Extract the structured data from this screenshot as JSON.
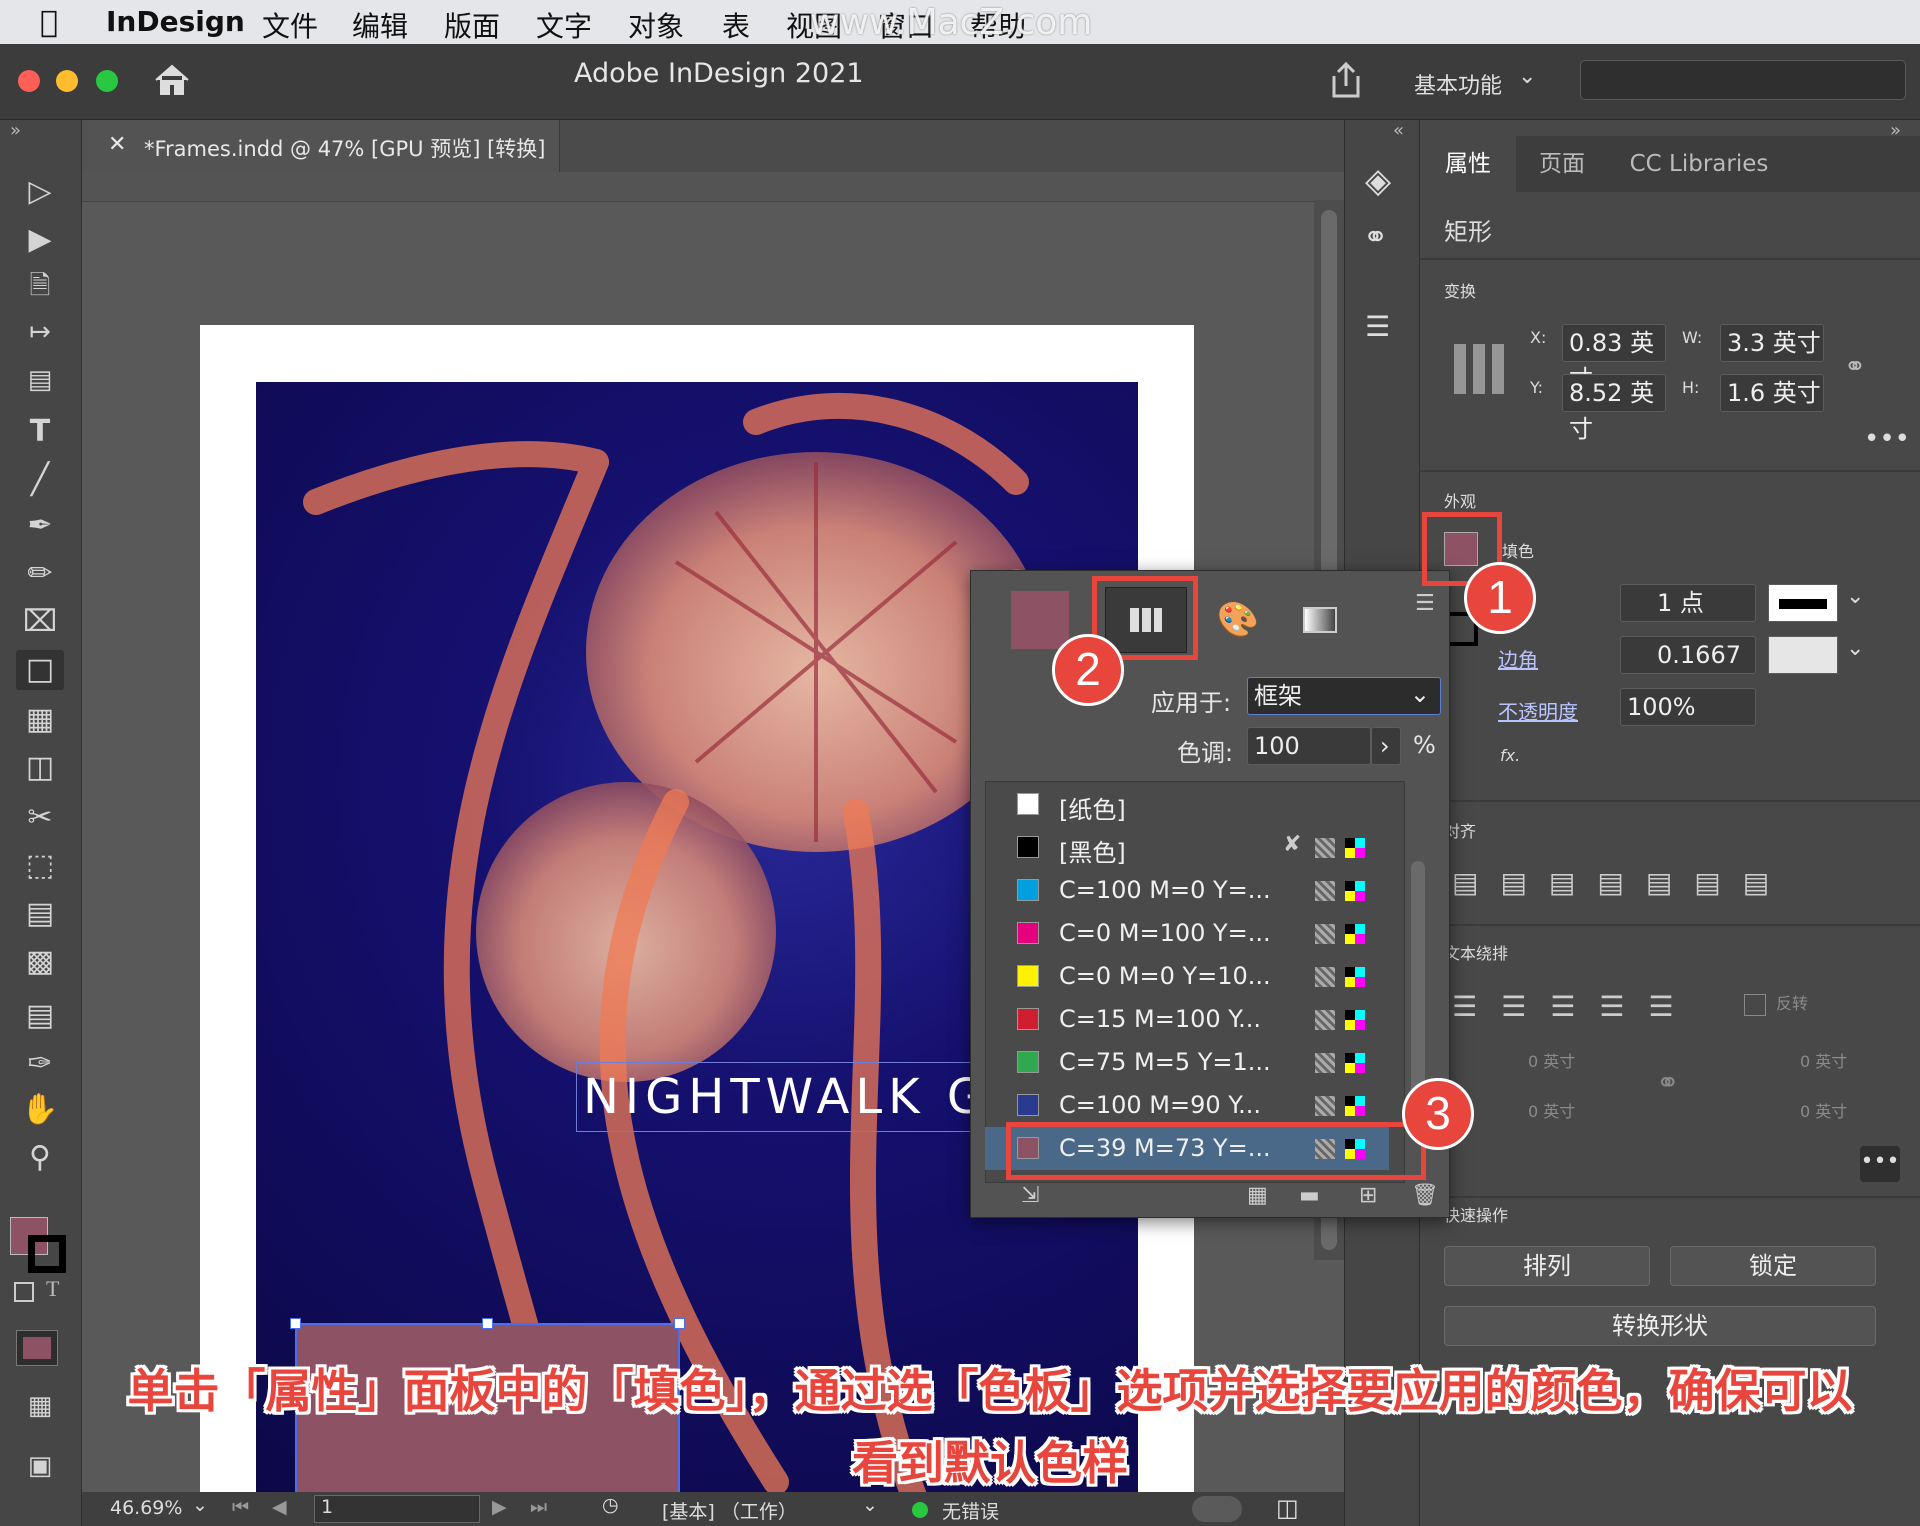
{
  "menubar": {
    "app": "InDesign",
    "items": [
      "文件",
      "编辑",
      "版面",
      "文字",
      "对象",
      "表",
      "视图",
      "窗口",
      "帮助"
    ],
    "watermark": "www.MacZ.com"
  },
  "titlebar": {
    "title": "Adobe InDesign 2021",
    "workspace": "基本功能"
  },
  "document": {
    "tab_label": "*Frames.indd @ 47% [GPU 预览] [转换]",
    "headline_text": "NIGHTWALK GU"
  },
  "statusbar": {
    "zoom": "46.69%",
    "page": "1",
    "profile": "[基本] （工作）",
    "errors": "无错误"
  },
  "properties": {
    "tabs": [
      "属性",
      "页面",
      "CC Libraries"
    ],
    "object_type": "矩形",
    "transform_title": "变换",
    "x_label": "X:",
    "x_value": "0.83 英寸",
    "y_label": "Y:",
    "y_value": "8.52 英寸",
    "w_label": "W:",
    "w_value": "3.3 英寸",
    "h_label": "H:",
    "h_value": "1.6 英寸",
    "appearance_title": "外观",
    "fill_label": "填色",
    "stroke_weight": "1 点",
    "corner_label": "边角",
    "corner_value": "0.1667",
    "opacity_label": "不透明度",
    "opacity_value": "100%",
    "fx_label": "fx.",
    "align_title": "对齐",
    "wrap_title": "文本绕排",
    "invert_label": "反转",
    "wrap_offset": "0 英寸",
    "quick_actions_title": "快速操作",
    "arrange_button": "排列",
    "lock_button": "锁定",
    "convert_shape_button": "转换形状"
  },
  "swatch_popup": {
    "apply_to_label": "应用于:",
    "apply_to_value": "框架",
    "tint_label": "色调:",
    "tint_value": "100",
    "tint_unit": "%",
    "swatches": [
      {
        "name": "[纸色]",
        "color": "#ffffff"
      },
      {
        "name": "[黑色]",
        "color": "#000000"
      },
      {
        "name": "C=100 M=0 Y=...",
        "color": "#00a0e0"
      },
      {
        "name": "C=0 M=100 Y=...",
        "color": "#e5007e"
      },
      {
        "name": "C=0 M=0 Y=10...",
        "color": "#fff200"
      },
      {
        "name": "C=15 M=100 Y...",
        "color": "#cf1f2e"
      },
      {
        "name": "C=75 M=5 Y=1...",
        "color": "#2fa84f"
      },
      {
        "name": "C=100 M=90 Y...",
        "color": "#2a3a8f"
      },
      {
        "name": "C=39 M=73 Y=...",
        "color": "#8e5265"
      }
    ],
    "selected_color": "#8e5265"
  },
  "callouts": [
    "1",
    "2",
    "3"
  ],
  "caption": {
    "line1": "单击「属性」面板中的「填色」，通过选「色板」选项并选择要应用的颜色，确保可以",
    "line2": "看到默认色样"
  }
}
